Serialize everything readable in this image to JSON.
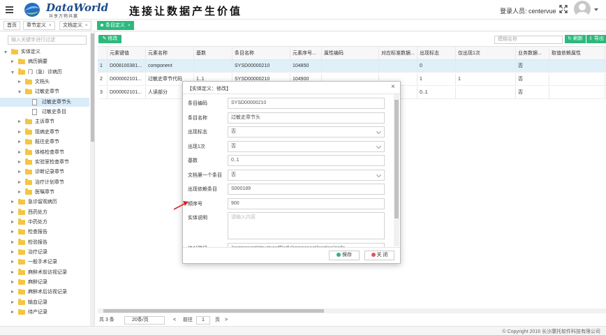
{
  "header": {
    "brand": "DataWorld",
    "brand_sub": "共享万物共赢",
    "slogan": "连接让数据产生价值",
    "login_label": "登录人员: centervue"
  },
  "tabs": [
    {
      "label": "首页",
      "closable": false,
      "active": false
    },
    {
      "label": "章节定义",
      "closable": true,
      "active": false
    },
    {
      "label": "文档定义",
      "closable": true,
      "active": false
    },
    {
      "label": "条目定义",
      "closable": true,
      "active": true
    }
  ],
  "sidebar": {
    "search_placeholder": "输入关键字进行过滤",
    "items": [
      {
        "label": "实体定义",
        "level": 0,
        "type": "folder",
        "state": "open"
      },
      {
        "label": "病历摘要",
        "level": 1,
        "type": "folder",
        "state": "closed"
      },
      {
        "label": "门（急）诊病历",
        "level": 1,
        "type": "folder",
        "state": "open"
      },
      {
        "label": "文档头",
        "level": 2,
        "type": "folder",
        "state": "closed"
      },
      {
        "label": "过敏史章节",
        "level": 2,
        "type": "folder",
        "state": "open"
      },
      {
        "label": "过敏史章节头",
        "level": 3,
        "type": "file",
        "state": "leaf",
        "selected": true
      },
      {
        "label": "过敏史条目",
        "level": 3,
        "type": "file",
        "state": "leaf"
      },
      {
        "label": "主诉章节",
        "level": 2,
        "type": "folder",
        "state": "closed"
      },
      {
        "label": "现病史章节",
        "level": 2,
        "type": "folder",
        "state": "closed"
      },
      {
        "label": "既往史章节",
        "level": 2,
        "type": "folder",
        "state": "closed"
      },
      {
        "label": "体格检查章节",
        "level": 2,
        "type": "folder",
        "state": "closed"
      },
      {
        "label": "实验室检查章节",
        "level": 2,
        "type": "folder",
        "state": "closed"
      },
      {
        "label": "诊断记录章节",
        "level": 2,
        "type": "folder",
        "state": "closed"
      },
      {
        "label": "治疗计划章节",
        "level": 2,
        "type": "folder",
        "state": "closed"
      },
      {
        "label": "医嘱章节",
        "level": 2,
        "type": "folder",
        "state": "closed"
      },
      {
        "label": "急诊留观病历",
        "level": 1,
        "type": "folder",
        "state": "closed"
      },
      {
        "label": "西药处方",
        "level": 1,
        "type": "folder",
        "state": "closed"
      },
      {
        "label": "中药处方",
        "level": 1,
        "type": "folder",
        "state": "closed"
      },
      {
        "label": "检查报告",
        "level": 1,
        "type": "folder",
        "state": "closed"
      },
      {
        "label": "检验报告",
        "level": 1,
        "type": "folder",
        "state": "closed"
      },
      {
        "label": "治疗记录",
        "level": 1,
        "type": "folder",
        "state": "closed"
      },
      {
        "label": "一般手术记录",
        "level": 1,
        "type": "folder",
        "state": "closed"
      },
      {
        "label": "麻醉术前访视记录",
        "level": 1,
        "type": "folder",
        "state": "closed"
      },
      {
        "label": "麻醉记录",
        "level": 1,
        "type": "folder",
        "state": "closed"
      },
      {
        "label": "麻醉术后访视记录",
        "level": 1,
        "type": "folder",
        "state": "closed"
      },
      {
        "label": "输血记录",
        "level": 1,
        "type": "folder",
        "state": "closed"
      },
      {
        "label": "待产记录",
        "level": 1,
        "type": "folder",
        "state": "closed"
      }
    ]
  },
  "toolbar": {
    "edit_label": "修改",
    "search_placeholder": "模糊名称",
    "refresh_label": "刷新",
    "export_label": "导出"
  },
  "table": {
    "columns": [
      "",
      "元素键值",
      "元素名称",
      "基数",
      "条目名称",
      "元素序号...",
      "属性编码",
      "对应标准数据...",
      "出现标志",
      "仅出现1次",
      "业务数据...",
      "取值依赖属性"
    ],
    "rows": [
      [
        "1",
        "D008100381...",
        "component",
        "",
        "SYSD00000210",
        "104850",
        "",
        "",
        "0",
        "",
        "否",
        ""
      ],
      [
        "2",
        "D000002101...",
        "过敏史章节代码",
        "1..1",
        "SYSD00000210",
        "104900",
        "",
        "",
        "1",
        "1",
        "否",
        ""
      ],
      [
        "3",
        "D000002101...",
        "人读部分",
        "",
        "",
        "",
        "",
        "",
        "0..1",
        "",
        "否",
        ""
      ]
    ]
  },
  "pager": {
    "total": "共 3 条",
    "page_size": "20条/页",
    "prev": "<",
    "next": ">",
    "goto_label": "前往",
    "page": "1",
    "page_unit": "页"
  },
  "footer": {
    "copyright": "© Copyright 2016 长沙康托软件科技有限公司"
  },
  "modal": {
    "title": "【实体定义：修改】",
    "fields": [
      {
        "label": "条目编码",
        "value": "SYSD00000210",
        "kind": "text"
      },
      {
        "label": "条目名称",
        "value": "过敏史章节头",
        "kind": "text"
      },
      {
        "label": "出现标志",
        "value": "否",
        "kind": "select"
      },
      {
        "label": "出现1次",
        "value": "否",
        "kind": "select"
      },
      {
        "label": "基数",
        "value": "0..1",
        "kind": "text"
      },
      {
        "label": "文档第一个条目",
        "value": "否",
        "kind": "select"
      },
      {
        "label": "出现依赖条目",
        "value": "S000189",
        "kind": "text"
      },
      {
        "label": "顺序号",
        "value": "900",
        "kind": "text"
      },
      {
        "label": "实体说明",
        "value": "",
        "placeholder": "请输入内容",
        "kind": "textarea"
      },
      {
        "label": "绝对路径",
        "value": "/component/structuredBody/component/section/code",
        "kind": "text"
      }
    ],
    "save_label": "保存",
    "close_label": "关 闭"
  },
  "colors": {
    "accent": "#2db87d",
    "selected_row": "#dff0f9",
    "brand_blue": "#1a4b8c"
  }
}
